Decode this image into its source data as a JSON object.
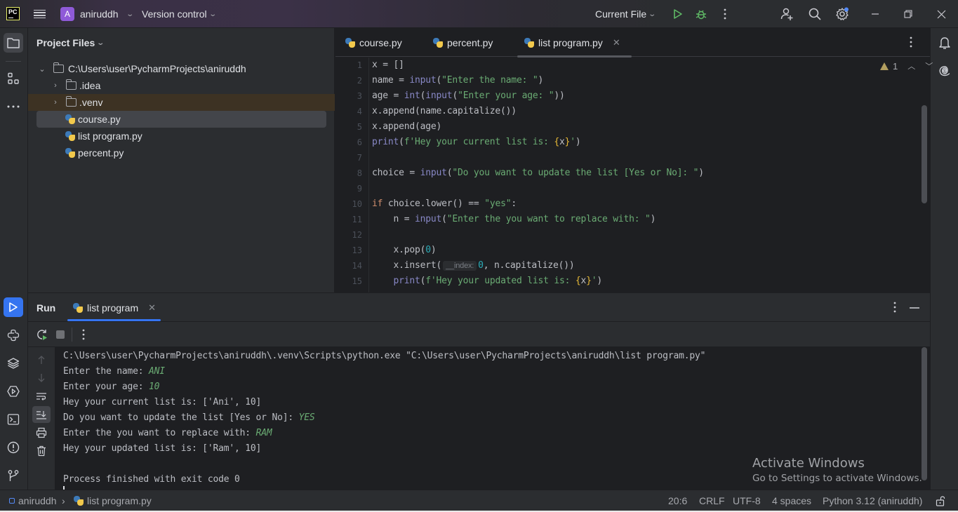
{
  "titlebar": {
    "logo": "PC",
    "project_avatar": "A",
    "project_name": "aniruddh",
    "vcs_label": "Version control",
    "run_config": "Current File",
    "icons": [
      "pycharm-logo",
      "hamburger-menu-icon",
      "chevron-down-icon",
      "run-icon",
      "debug-icon",
      "more-vertical-icon",
      "add-user-icon",
      "search-icon",
      "settings-icon",
      "minimize-icon",
      "maximize-icon",
      "close-icon"
    ]
  },
  "left_strip": {
    "top": [
      "folder-icon",
      "structure-icon",
      "more-horizontal-icon"
    ],
    "bottom": [
      "run-icon",
      "python-console-icon",
      "layers-icon",
      "services-icon",
      "terminal-icon",
      "problems-icon",
      "git-icon"
    ]
  },
  "right_strip": [
    "bell-icon",
    "ai-assistant-icon"
  ],
  "project": {
    "title": "Project Files",
    "root": "C:\\Users\\user\\PycharmProjects\\aniruddh",
    "items": [
      {
        "name": ".idea",
        "type": "folder"
      },
      {
        "name": ".venv",
        "type": "folder"
      },
      {
        "name": "course.py",
        "type": "python"
      },
      {
        "name": "list program.py",
        "type": "python"
      },
      {
        "name": "percent.py",
        "type": "python"
      }
    ]
  },
  "editor": {
    "tabs": [
      {
        "label": "course.py"
      },
      {
        "label": "percent.py"
      },
      {
        "label": "list program.py",
        "active": true
      }
    ],
    "warning_count": "1",
    "line_numbers": [
      "1",
      "2",
      "3",
      "4",
      "5",
      "6",
      "7",
      "8",
      "9",
      "10",
      "11",
      "12",
      "13",
      "14",
      "15"
    ],
    "param_hint": "__index:",
    "lines": [
      "x = []",
      "name = input(\"Enter the name: \")",
      "age = int(input(\"Enter your age: \"))",
      "x.append(name.capitalize())",
      "x.append(age)",
      "print(f'Hey your current list is: {x}')",
      "",
      "choice = input(\"Do you want to update the list [Yes or No]: \")",
      "",
      "if choice.lower() == \"yes\":",
      "    n = input(\"Enter the you want to replace with: \")",
      "",
      "    x.pop(0)",
      "    x.insert(__index: 0, n.capitalize())",
      "    print(f'Hey your updated list is: {x}')"
    ]
  },
  "run": {
    "title": "Run",
    "tab_label": "list program",
    "console": [
      {
        "text": "C:\\Users\\user\\PycharmProjects\\aniruddh\\.venv\\Scripts\\python.exe \"C:\\Users\\user\\PycharmProjects\\aniruddh\\list program.py\"",
        "input": ""
      },
      {
        "text": "Enter the name: ",
        "input": "ANI"
      },
      {
        "text": "Enter your age: ",
        "input": "10"
      },
      {
        "text": "Hey your current list is: ['Ani', 10]",
        "input": ""
      },
      {
        "text": "Do you want to update the list [Yes or No]: ",
        "input": "YES"
      },
      {
        "text": "Enter the you want to replace with: ",
        "input": "RAM"
      },
      {
        "text": "Hey your updated list is: ['Ram', 10]",
        "input": ""
      },
      {
        "text": "",
        "input": ""
      },
      {
        "text": "Process finished with exit code 0",
        "input": ""
      }
    ]
  },
  "watermark": {
    "title": "Activate Windows",
    "subtitle": "Go to Settings to activate Windows."
  },
  "statusbar": {
    "project": "aniruddh",
    "file": "list program.py",
    "position": "20:6",
    "line_sep": "CRLF",
    "encoding": "UTF-8",
    "indent": "4 spaces",
    "interpreter": "Python 3.12 (aniruddh)"
  },
  "colors": {
    "accent": "#3574f0",
    "keyword": "#cf8e6d",
    "builtin": "#8888c6",
    "string": "#6aab73",
    "number": "#2aacb8",
    "warning": "#b29e5f"
  }
}
